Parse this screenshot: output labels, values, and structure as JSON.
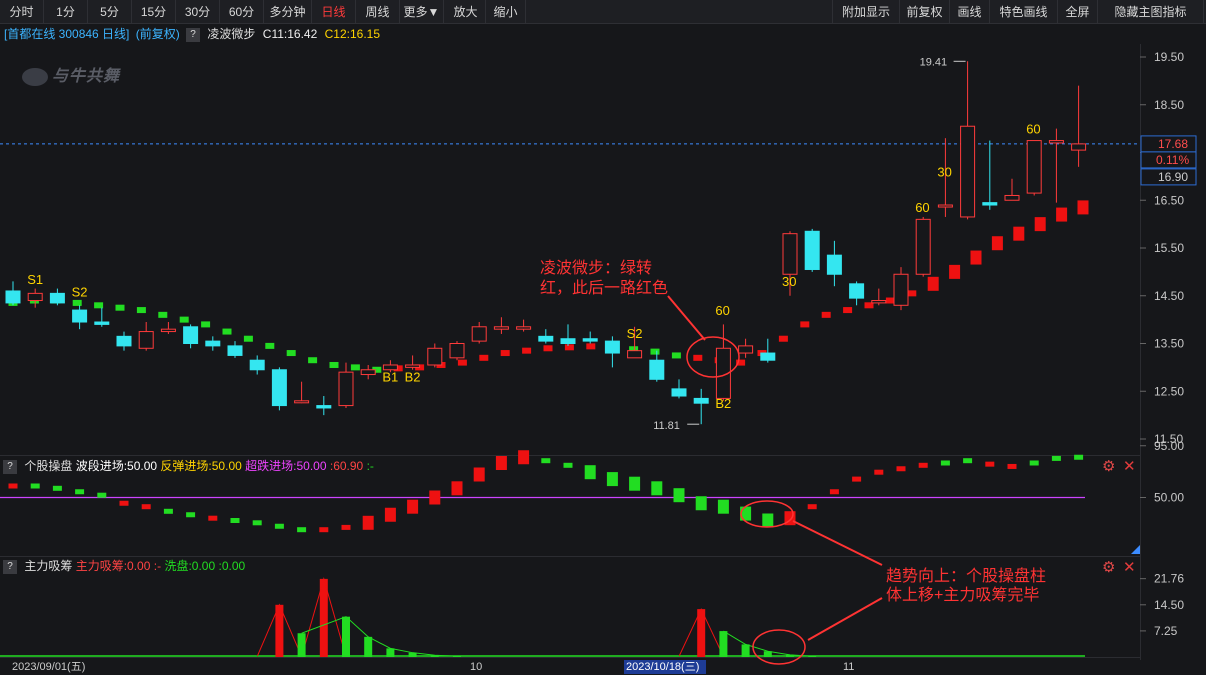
{
  "toolbar": {
    "left": [
      "分时",
      "1分",
      "5分",
      "15分",
      "30分",
      "60分",
      "多分钟",
      "日线",
      "周线",
      "更多▼",
      "放大",
      "缩小"
    ],
    "active": "日线",
    "right": [
      "附加显示",
      "前复权",
      "画线",
      "特色画线",
      "全屏",
      "隐藏主图指标"
    ]
  },
  "info": {
    "stock": "[首都在线 300846 日线]",
    "adjust": "(前复权)",
    "indicator": "凌波微步",
    "c1": "C11:16.42",
    "c2": "C12:16.15"
  },
  "watermark": "与牛共舞",
  "price": {
    "current": "17.68",
    "pct": "0.11%",
    "level2": "16.90",
    "high_label": "19.41",
    "low_label": "11.81",
    "axis": [
      "19.50",
      "18.50",
      "17.50",
      "16.50",
      "15.50",
      "14.50",
      "13.50",
      "12.50",
      "11.50"
    ]
  },
  "sub1": {
    "name": "个股操盘",
    "l1": "波段进场:50.00",
    "l2": "反弹进场:50.00",
    "l3": "超跌进场:50.00",
    "l4": ":60.90",
    "l5": ":-",
    "axis": [
      "95.00",
      "50.00"
    ]
  },
  "sub2": {
    "name": "主力吸筹",
    "l1": "主力吸筹:0.00",
    "l2": ":-",
    "l3": "洗盘:0.00",
    "l4": ":0.00",
    "axis": [
      "21.76",
      "14.50",
      "7.25"
    ]
  },
  "xaxis": {
    "d1": "2023/09/01(五)",
    "m10": "10",
    "d2": "2023/10/18(三)",
    "m11": "11"
  },
  "annotations": {
    "a1_l1": "凌波微步：绿转",
    "a1_l2": "红，此后一路红色",
    "a2_l1": "趋势向上：个股操盘柱",
    "a2_l2": "体上移+主力吸筹完毕"
  },
  "labels": [
    "S1",
    "S2",
    "B1",
    "B2",
    "S2",
    "60",
    "B2",
    "30",
    "60",
    "30",
    "60"
  ],
  "colors": {
    "up": "#ff3b3b",
    "down": "#34e6f0",
    "ma_green": "#22dd22",
    "ma_red": "#ee1111",
    "purple": "#cc44ff",
    "annot": "#ff3333",
    "label": "#ffd400"
  },
  "chart_data": {
    "type": "candlestick",
    "ohlc": [
      [
        14.6,
        14.8,
        14.3,
        14.35
      ],
      [
        14.4,
        14.65,
        14.25,
        14.55
      ],
      [
        14.55,
        14.65,
        14.3,
        14.35
      ],
      [
        14.2,
        14.3,
        13.8,
        13.95
      ],
      [
        13.95,
        14.25,
        13.85,
        13.9
      ],
      [
        13.65,
        13.75,
        13.35,
        13.45
      ],
      [
        13.4,
        13.95,
        13.35,
        13.75
      ],
      [
        13.75,
        13.95,
        13.7,
        13.8
      ],
      [
        13.85,
        13.9,
        13.4,
        13.5
      ],
      [
        13.55,
        13.65,
        13.35,
        13.45
      ],
      [
        13.45,
        13.55,
        13.2,
        13.25
      ],
      [
        13.15,
        13.25,
        12.85,
        12.95
      ],
      [
        12.95,
        13.0,
        12.1,
        12.2
      ],
      [
        12.3,
        12.7,
        12.25,
        12.3
      ],
      [
        12.2,
        12.4,
        12.0,
        12.15
      ],
      [
        12.2,
        13.1,
        12.15,
        12.9
      ],
      [
        12.85,
        13.05,
        12.75,
        12.95
      ],
      [
        12.95,
        13.15,
        12.9,
        13.05
      ],
      [
        13.0,
        13.25,
        12.95,
        13.05
      ],
      [
        13.05,
        13.5,
        13.0,
        13.4
      ],
      [
        13.2,
        13.55,
        13.15,
        13.5
      ],
      [
        13.55,
        13.95,
        13.5,
        13.85
      ],
      [
        13.8,
        14.05,
        13.7,
        13.85
      ],
      [
        13.8,
        14.0,
        13.75,
        13.85
      ],
      [
        13.65,
        13.8,
        13.5,
        13.55
      ],
      [
        13.6,
        13.9,
        13.45,
        13.5
      ],
      [
        13.6,
        13.75,
        13.5,
        13.55
      ],
      [
        13.55,
        13.65,
        13.0,
        13.3
      ],
      [
        13.2,
        13.85,
        13.2,
        13.35
      ],
      [
        13.15,
        13.35,
        12.7,
        12.75
      ],
      [
        12.55,
        12.75,
        12.35,
        12.4
      ],
      [
        12.35,
        12.55,
        11.81,
        12.25
      ],
      [
        12.35,
        13.9,
        12.3,
        13.4
      ],
      [
        13.3,
        13.6,
        13.2,
        13.45
      ],
      [
        13.3,
        13.6,
        13.1,
        13.15
      ],
      [
        14.95,
        15.85,
        14.5,
        15.8
      ],
      [
        15.85,
        15.9,
        15.0,
        15.05
      ],
      [
        15.35,
        15.65,
        14.7,
        14.95
      ],
      [
        14.75,
        14.8,
        14.3,
        14.45
      ],
      [
        14.35,
        14.65,
        14.3,
        14.4
      ],
      [
        14.3,
        15.1,
        14.2,
        14.95
      ],
      [
        14.95,
        16.15,
        14.9,
        16.1
      ],
      [
        16.4,
        17.8,
        16.15,
        16.4
      ],
      [
        16.15,
        19.41,
        16.1,
        18.05
      ],
      [
        16.45,
        17.75,
        16.3,
        16.4
      ],
      [
        16.5,
        16.95,
        16.5,
        16.6
      ],
      [
        16.65,
        17.7,
        16.6,
        17.75
      ],
      [
        17.7,
        18.0,
        16.45,
        17.75
      ],
      [
        17.55,
        18.9,
        17.2,
        17.68
      ]
    ],
    "ma": [
      14.35,
      14.4,
      14.4,
      14.35,
      14.3,
      14.25,
      14.2,
      14.1,
      14.0,
      13.9,
      13.75,
      13.6,
      13.45,
      13.3,
      13.15,
      13.05,
      13.0,
      12.95,
      12.98,
      13.0,
      13.05,
      13.1,
      13.2,
      13.3,
      13.35,
      13.4,
      13.42,
      13.44,
      13.42,
      13.38,
      13.33,
      13.25,
      13.2,
      13.15,
      13.1,
      13.3,
      13.6,
      13.9,
      14.1,
      14.2,
      14.3,
      14.4,
      14.55,
      14.75,
      15.0,
      15.3,
      15.6,
      15.8,
      16.0,
      16.2,
      16.35
    ],
    "ma_color": [
      "g",
      "g",
      "g",
      "g",
      "g",
      "g",
      "g",
      "g",
      "g",
      "g",
      "g",
      "g",
      "g",
      "g",
      "g",
      "g",
      "g",
      "g",
      "r",
      "r",
      "r",
      "r",
      "r",
      "r",
      "r",
      "r",
      "r",
      "r",
      "g",
      "g",
      "g",
      "g",
      "r",
      "r",
      "r",
      "r",
      "r",
      "r",
      "r",
      "r",
      "r",
      "r",
      "r",
      "r",
      "r",
      "r",
      "r",
      "r",
      "r",
      "r",
      "r"
    ],
    "sub1": [
      60,
      60,
      58,
      55,
      52,
      45,
      42,
      38,
      35,
      32,
      30,
      28,
      25,
      22,
      22,
      24,
      28,
      35,
      42,
      50,
      58,
      70,
      80,
      85,
      82,
      78,
      72,
      66,
      62,
      58,
      52,
      45,
      42,
      36,
      30,
      32,
      42,
      55,
      66,
      72,
      75,
      78,
      80,
      82,
      79,
      77,
      80,
      84,
      85,
      88,
      85,
      84,
      75,
      70,
      68,
      65,
      68,
      62
    ],
    "sub1_color": [
      "r",
      "g",
      "g",
      "g",
      "g",
      "r",
      "r",
      "g",
      "g",
      "r",
      "g",
      "g",
      "g",
      "g",
      "r",
      "r",
      "r",
      "r",
      "r",
      "r",
      "r",
      "r",
      "r",
      "r",
      "g",
      "g",
      "g",
      "g",
      "g",
      "g",
      "g",
      "g",
      "g",
      "g",
      "g",
      "r",
      "r",
      "r",
      "r",
      "r",
      "r",
      "r",
      "g",
      "g",
      "r",
      "r",
      "g",
      "g",
      "g",
      "g",
      "r"
    ],
    "sub2_red": [
      [
        0,
        0
      ],
      [
        0,
        0
      ],
      [
        0,
        0
      ],
      [
        0,
        0
      ],
      [
        0,
        0
      ],
      [
        0,
        0
      ],
      [
        0,
        0
      ],
      [
        0,
        0
      ],
      [
        0,
        0
      ],
      [
        0,
        0
      ],
      [
        0,
        0
      ],
      [
        0,
        0
      ],
      [
        13,
        14.0
      ],
      [
        14,
        0
      ],
      [
        15,
        18.0
      ],
      [
        16,
        0
      ]
    ],
    "sub2_green": [
      5.8,
      3.2,
      11.5,
      6.0,
      2.2,
      1.2,
      0.5,
      0.2,
      7.5,
      4.0,
      1.8,
      0.7
    ]
  }
}
